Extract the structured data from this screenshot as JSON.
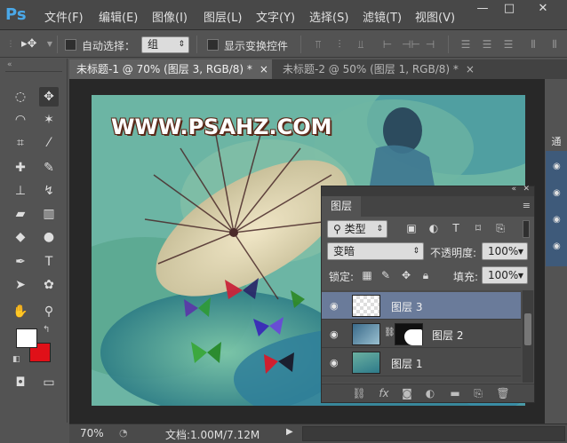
{
  "app": {
    "logo": "Ps"
  },
  "menu": [
    "文件(F)",
    "编辑(E)",
    "图像(I)",
    "图层(L)",
    "文字(Y)",
    "选择(S)",
    "滤镜(T)",
    "视图(V)"
  ],
  "window_buttons": {
    "minimize": "—",
    "restore": "□",
    "close": "✕"
  },
  "options": {
    "auto_select_label": "自动选择：",
    "auto_select_value": "组",
    "show_transform_label": "显示变换控件"
  },
  "tabs": [
    {
      "label": "未标题-1 @ 70% (图层 3, RGB/8) *",
      "close": "×"
    },
    {
      "label": "未标题-2 @ 50% (图层 1, RGB/8) *",
      "close": "×"
    }
  ],
  "canvas": {
    "watermark": "WWW.PSAHZ.COM"
  },
  "layers_panel": {
    "tab": "图层",
    "filter_value": "类型",
    "blend_mode": "变暗",
    "opacity_label": "不透明度:",
    "opacity_value": "100%",
    "lock_label": "锁定:",
    "fill_label": "填充:",
    "fill_value": "100%",
    "layers": [
      {
        "name": "图层 3",
        "selected": true
      },
      {
        "name": "图层 2",
        "selected": false
      },
      {
        "name": "图层 1",
        "selected": false
      }
    ]
  },
  "right_dock": {
    "label": "通"
  },
  "status": {
    "zoom": "70%",
    "doc_info": "文档:1.00M/7.12M"
  },
  "colors": {
    "foreground": "#ffffff",
    "background": "#e01018",
    "selection": "#6a7b9a",
    "logo": "#4aa8e8"
  }
}
